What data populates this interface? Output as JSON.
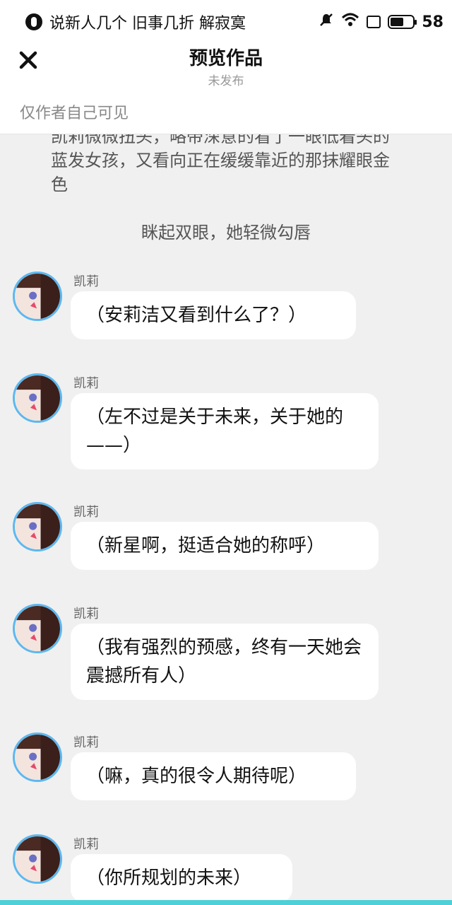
{
  "status_bar": {
    "notification_text": "说新人几个 旧事几折 解寂寞",
    "battery": "58",
    "icons": [
      "app-icon",
      "mute-icon",
      "wifi-icon",
      "screen-icon",
      "battery-icon"
    ]
  },
  "header": {
    "title": "预览作品",
    "subtitle": "未发布",
    "close_icon": "close-icon"
  },
  "visibility": "仅作者自己可见",
  "narration": [
    "凯莉微微扭头，略带深意的看了一眼低着头的蓝发女孩，又看向正在缓缓靠近的那抹耀眼金色",
    "眯起双眼，她轻微勾唇"
  ],
  "messages": [
    {
      "sender": "凯莉",
      "text": "（安莉洁又看到什么了？）"
    },
    {
      "sender": "凯莉",
      "text": "（左不过是关于未来，关于她的——）"
    },
    {
      "sender": "凯莉",
      "text": "（新星啊，挺适合她的称呼）"
    },
    {
      "sender": "凯莉",
      "text": "（我有强烈的预感，终有一天她会震撼所有人）"
    },
    {
      "sender": "凯莉",
      "text": "（嘛，真的很令人期待呢）"
    },
    {
      "sender": "凯莉",
      "text": "（你所规划的未来）"
    }
  ],
  "colors": {
    "avatar_ring": "#5cb8f0",
    "bottom_accent": "#4dd0d8",
    "background": "#f0f0f0"
  }
}
